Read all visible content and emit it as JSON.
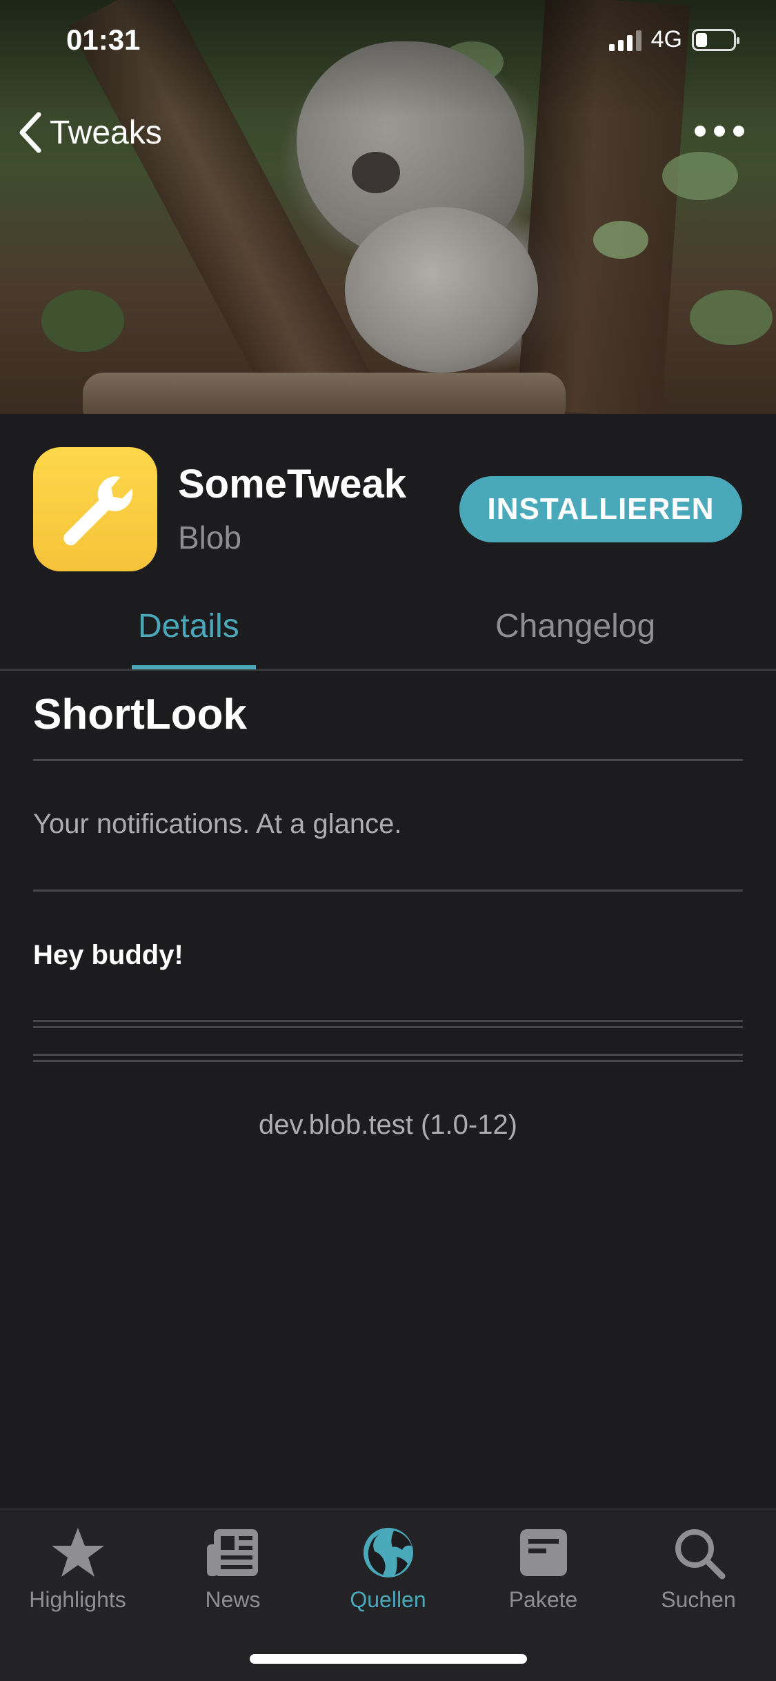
{
  "status_bar": {
    "time": "01:31",
    "network": "4G",
    "battery_level": 0.3
  },
  "nav": {
    "back_label": "Tweaks",
    "back_icon": "chevron-left-icon",
    "more_icon": "ellipsis-icon"
  },
  "package": {
    "name": "SomeTweak",
    "author": "Blob",
    "icon": "wrench-icon",
    "install_label": "INSTALLIEREN"
  },
  "tabs": [
    {
      "label": "Details",
      "active": true
    },
    {
      "label": "Changelog",
      "active": false
    }
  ],
  "content": {
    "title": "ShortLook",
    "tagline": "Your notifications. At a glance.",
    "body_heading": "Hey buddy!",
    "package_id": "dev.blob.test (1.0-12)"
  },
  "tabbar": [
    {
      "label": "Highlights",
      "icon": "star-icon",
      "active": false
    },
    {
      "label": "News",
      "icon": "newspaper-icon",
      "active": false
    },
    {
      "label": "Quellen",
      "icon": "globe-icon",
      "active": true
    },
    {
      "label": "Pakete",
      "icon": "package-icon",
      "active": false
    },
    {
      "label": "Suchen",
      "icon": "search-icon",
      "active": false
    }
  ],
  "colors": {
    "accent": "#4aa8bb",
    "background": "#1c1c1e",
    "icon_yellow": "#f8cb3f",
    "inactive": "#8e8e93"
  }
}
